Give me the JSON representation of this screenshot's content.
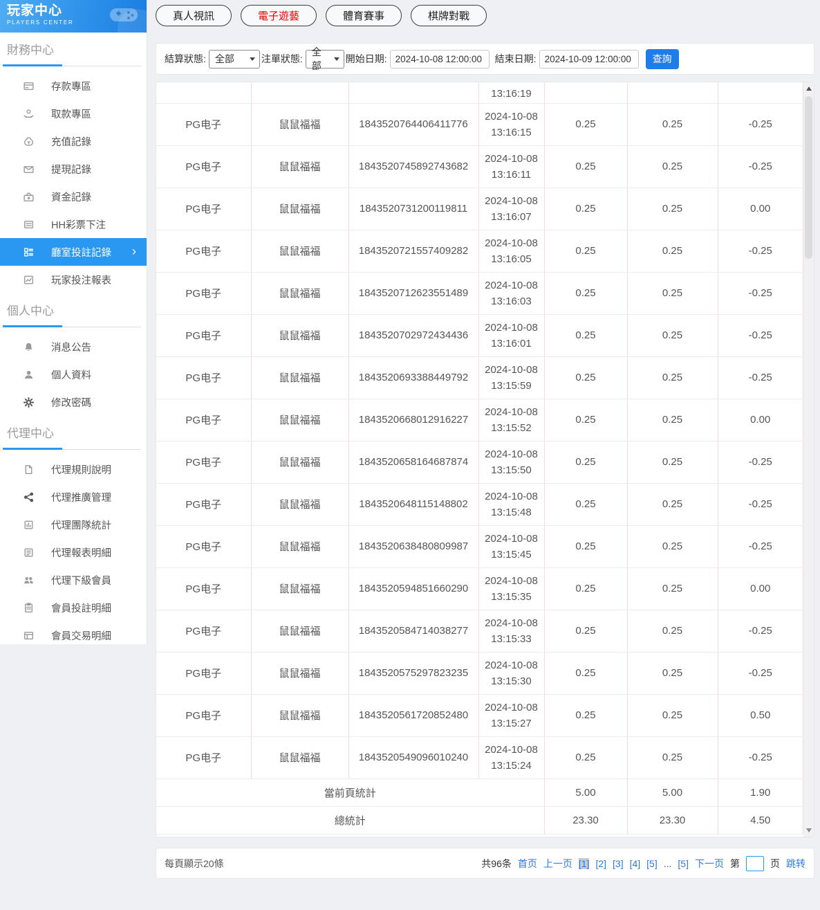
{
  "colors": {
    "accent_blue": "#2a97f0",
    "button_blue": "#1f7ce8",
    "active_tab_red": "#ef0000",
    "link_blue": "#2b7be0",
    "table_vertical_border": "#f6d8d8",
    "current_page_bg": "#c3cbd3"
  },
  "sidebar": {
    "logo": {
      "title": "玩家中心",
      "subtitle": "PLAYERS CENTER"
    },
    "sections": [
      {
        "title": "財務中心",
        "items": [
          {
            "label": "存款專區",
            "icon": "deposit-card-icon"
          },
          {
            "label": "取款專區",
            "icon": "withdraw-hand-icon"
          },
          {
            "label": "充值記錄",
            "icon": "recharge-moneybag-icon"
          },
          {
            "label": "提現記錄",
            "icon": "cashout-envelope-icon"
          },
          {
            "label": "資金記錄",
            "icon": "funds-purse-icon"
          },
          {
            "label": "HH彩票下注",
            "icon": "lottery-list-icon"
          },
          {
            "label": "廳室投註記錄",
            "icon": "bet-records-icon",
            "active": true,
            "chevron": "›"
          },
          {
            "label": "玩家投注報表",
            "icon": "player-report-chart-icon"
          }
        ]
      },
      {
        "title": "個人中心",
        "items": [
          {
            "label": "消息公告",
            "icon": "bell-icon"
          },
          {
            "label": "個人資料",
            "icon": "user-icon"
          },
          {
            "label": "修改密碼",
            "icon": "gear-icon"
          }
        ]
      },
      {
        "title": "代理中心",
        "items": [
          {
            "label": "代理規則說明",
            "icon": "document-icon"
          },
          {
            "label": "代理推廣管理",
            "icon": "share-icon"
          },
          {
            "label": "代理團隊統計",
            "icon": "team-stats-icon"
          },
          {
            "label": "代理報表明細",
            "icon": "report-detail-icon"
          },
          {
            "label": "代理下級會員",
            "icon": "subordinate-users-icon"
          },
          {
            "label": "會員投註明細",
            "icon": "member-bet-clipboard-icon"
          },
          {
            "label": "會員交易明細",
            "icon": "member-transaction-list-icon"
          }
        ]
      }
    ]
  },
  "tabs": [
    {
      "label": "真人視訊",
      "active": false
    },
    {
      "label": "電子遊藝",
      "active": true
    },
    {
      "label": "體育賽事",
      "active": false
    },
    {
      "label": "棋牌對戰",
      "active": false
    }
  ],
  "filters": {
    "settle_status_label": "結算狀態:",
    "settle_status_value": "全部",
    "order_status_label": "注單狀態:",
    "order_status_value": "全部",
    "start_date_label": "開始日期:",
    "start_date_value": "2024-10-08 12:00:00",
    "end_date_label": "結束日期:",
    "end_date_value": "2024-10-09 12:00:00",
    "search_label": "查詢"
  },
  "table": {
    "partial_row_time": "13:16:19",
    "rows": [
      {
        "provider": "PG电子",
        "game": "鼠鼠福福",
        "order_id": "1843520764406411776",
        "date": "2024-10-08",
        "time": "13:16:15",
        "bet": "0.25",
        "valid": "0.25",
        "result": "-0.25"
      },
      {
        "provider": "PG电子",
        "game": "鼠鼠福福",
        "order_id": "1843520745892743682",
        "date": "2024-10-08",
        "time": "13:16:11",
        "bet": "0.25",
        "valid": "0.25",
        "result": "-0.25"
      },
      {
        "provider": "PG电子",
        "game": "鼠鼠福福",
        "order_id": "1843520731200119811",
        "date": "2024-10-08",
        "time": "13:16:07",
        "bet": "0.25",
        "valid": "0.25",
        "result": "0.00"
      },
      {
        "provider": "PG电子",
        "game": "鼠鼠福福",
        "order_id": "1843520721557409282",
        "date": "2024-10-08",
        "time": "13:16:05",
        "bet": "0.25",
        "valid": "0.25",
        "result": "-0.25"
      },
      {
        "provider": "PG电子",
        "game": "鼠鼠福福",
        "order_id": "1843520712623551489",
        "date": "2024-10-08",
        "time": "13:16:03",
        "bet": "0.25",
        "valid": "0.25",
        "result": "-0.25"
      },
      {
        "provider": "PG电子",
        "game": "鼠鼠福福",
        "order_id": "1843520702972434436",
        "date": "2024-10-08",
        "time": "13:16:01",
        "bet": "0.25",
        "valid": "0.25",
        "result": "-0.25"
      },
      {
        "provider": "PG电子",
        "game": "鼠鼠福福",
        "order_id": "1843520693388449792",
        "date": "2024-10-08",
        "time": "13:15:59",
        "bet": "0.25",
        "valid": "0.25",
        "result": "-0.25"
      },
      {
        "provider": "PG电子",
        "game": "鼠鼠福福",
        "order_id": "1843520668012916227",
        "date": "2024-10-08",
        "time": "13:15:52",
        "bet": "0.25",
        "valid": "0.25",
        "result": "0.00"
      },
      {
        "provider": "PG电子",
        "game": "鼠鼠福福",
        "order_id": "1843520658164687874",
        "date": "2024-10-08",
        "time": "13:15:50",
        "bet": "0.25",
        "valid": "0.25",
        "result": "-0.25"
      },
      {
        "provider": "PG电子",
        "game": "鼠鼠福福",
        "order_id": "1843520648115148802",
        "date": "2024-10-08",
        "time": "13:15:48",
        "bet": "0.25",
        "valid": "0.25",
        "result": "-0.25"
      },
      {
        "provider": "PG电子",
        "game": "鼠鼠福福",
        "order_id": "1843520638480809987",
        "date": "2024-10-08",
        "time": "13:15:45",
        "bet": "0.25",
        "valid": "0.25",
        "result": "-0.25"
      },
      {
        "provider": "PG电子",
        "game": "鼠鼠福福",
        "order_id": "1843520594851660290",
        "date": "2024-10-08",
        "time": "13:15:35",
        "bet": "0.25",
        "valid": "0.25",
        "result": "0.00"
      },
      {
        "provider": "PG电子",
        "game": "鼠鼠福福",
        "order_id": "1843520584714038277",
        "date": "2024-10-08",
        "time": "13:15:33",
        "bet": "0.25",
        "valid": "0.25",
        "result": "-0.25"
      },
      {
        "provider": "PG电子",
        "game": "鼠鼠福福",
        "order_id": "1843520575297823235",
        "date": "2024-10-08",
        "time": "13:15:30",
        "bet": "0.25",
        "valid": "0.25",
        "result": "-0.25"
      },
      {
        "provider": "PG电子",
        "game": "鼠鼠福福",
        "order_id": "1843520561720852480",
        "date": "2024-10-08",
        "time": "13:15:27",
        "bet": "0.25",
        "valid": "0.25",
        "result": "0.50"
      },
      {
        "provider": "PG电子",
        "game": "鼠鼠福福",
        "order_id": "1843520549096010240",
        "date": "2024-10-08",
        "time": "13:15:24",
        "bet": "0.25",
        "valid": "0.25",
        "result": "-0.25"
      }
    ],
    "summary": [
      {
        "label": "當前頁統計",
        "bet": "5.00",
        "valid": "5.00",
        "result": "1.90"
      },
      {
        "label": "總統計",
        "bet": "23.30",
        "valid": "23.30",
        "result": "4.50"
      }
    ]
  },
  "pagination": {
    "per_page": "每頁顯示20條",
    "total": "共96条",
    "first": "首页",
    "prev": "上一页",
    "pages": [
      "[1]",
      "[2]",
      "[3]",
      "[4]",
      "[5]"
    ],
    "ellipsis": "...",
    "last_page": "[5]",
    "next": "下一页",
    "jump_prefix": "第",
    "jump_suffix": "页",
    "jump_label": "跳转"
  }
}
